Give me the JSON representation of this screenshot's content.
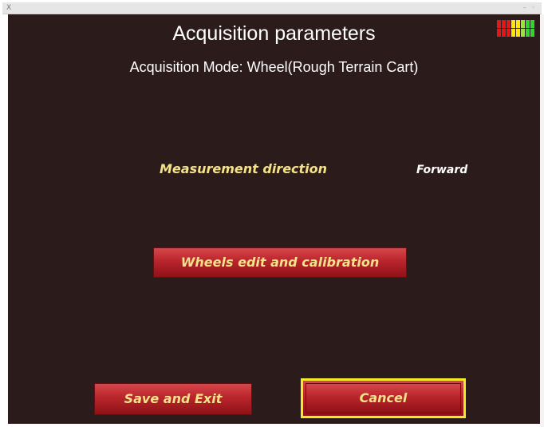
{
  "window": {
    "icon": "X",
    "controls": "– ◦"
  },
  "screen": {
    "title": "Acquisition parameters",
    "subtitle": "Acquisition Mode: Wheel(Rough Terrain Cart)"
  },
  "settings": {
    "direction_label": "Measurement direction",
    "direction_value": "Forward"
  },
  "buttons": {
    "wheels": "Wheels edit and calibration",
    "save": "Save and Exit",
    "cancel": "Cancel"
  },
  "signal_meter": {
    "colors": [
      "#e01818",
      "#e01818",
      "#e01818",
      "#ffe600",
      "#ffe600",
      "#9be23a",
      "#2fd62f",
      "#2fd62f"
    ]
  }
}
